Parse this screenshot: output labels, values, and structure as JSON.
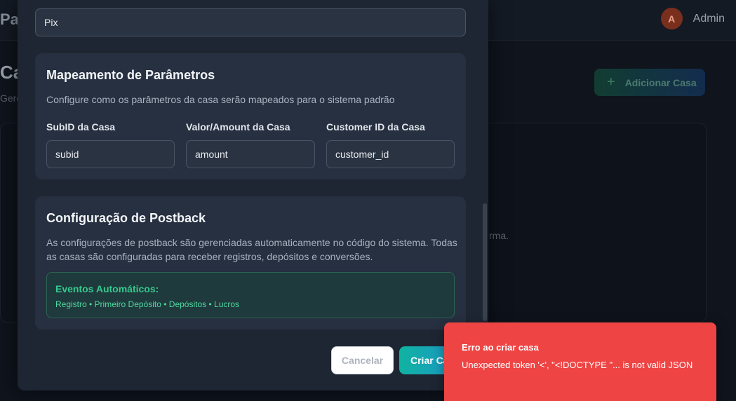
{
  "background": {
    "brand": "Pa",
    "user": {
      "avatar_letter": "A",
      "name": "Admin"
    },
    "page_title": "Ca",
    "page_subtitle": "Gere",
    "add_button_label": "Adicionar Casa",
    "empty_text": "rma."
  },
  "modal": {
    "payment_method_value": "Pix",
    "mapping": {
      "title": "Mapeamento de Parâmetros",
      "description": "Configure como os parâmetros da casa serão mapeados para o sistema padrão",
      "fields": [
        {
          "label": "SubID da Casa",
          "value": "subid"
        },
        {
          "label": "Valor/Amount da Casa",
          "value": "amount"
        },
        {
          "label": "Customer ID da Casa",
          "value": "customer_id"
        }
      ]
    },
    "postback": {
      "title": "Configuração de Postback",
      "description": "As configurações de postback são gerenciadas automaticamente no código do sistema. Todas as casas são configuradas para receber registros, depósitos e conversões.",
      "events_title": "Eventos Automáticos:",
      "events_list": "Registro • Primeiro Depósito • Depósitos • Lucros"
    },
    "buttons": {
      "cancel": "Cancelar",
      "create": "Criar Casa"
    }
  },
  "toast": {
    "title": "Erro ao criar casa",
    "message": "Unexpected token '<', \"<!DOCTYPE \"... is not valid JSON",
    "color": "#ef4444"
  },
  "colors": {
    "accent_gradient_start": "#10b3a0",
    "accent_gradient_end": "#1f8fd6",
    "success_text": "#36c98f"
  }
}
